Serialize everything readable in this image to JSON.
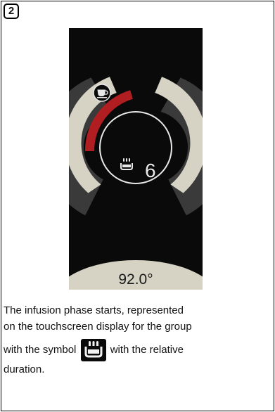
{
  "step_badge": "2",
  "display": {
    "counter_value": "6",
    "temperature": "92.0°",
    "icons": {
      "top": "coffee-cup-icon",
      "center": "infusion-icon"
    },
    "colors": {
      "screen_bg": "#0a0a0a",
      "ring": "#d6d2c4",
      "ring_shadow": "#3a3a3a",
      "progress_arc": "#b01e22",
      "text": "#e8e8e8"
    },
    "infusion_progress_fraction": 0.22
  },
  "description": {
    "line1": "The infusion phase starts, represented",
    "line2": "on the touchscreen display for the group",
    "line3_before_icon": "with the symbol",
    "line3_after_icon": "with the relative",
    "line4": "duration.",
    "inline_icon": "infusion-icon"
  }
}
